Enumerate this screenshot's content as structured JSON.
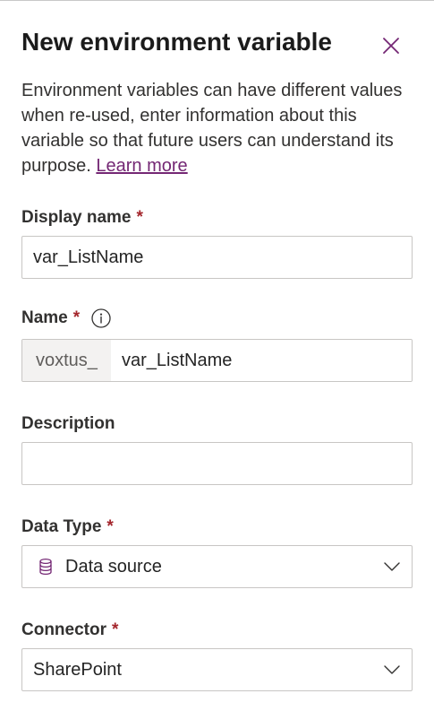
{
  "panel": {
    "title": "New environment variable",
    "description": "Environment variables can have different values when re-used, enter information about this variable so that future users can understand its purpose.",
    "learn_more": "Learn more"
  },
  "fields": {
    "display_name": {
      "label": "Display name",
      "required_mark": "*",
      "value": "var_ListName"
    },
    "name": {
      "label": "Name",
      "required_mark": "*",
      "prefix": "voxtus_",
      "value": "var_ListName"
    },
    "description": {
      "label": "Description",
      "value": ""
    },
    "data_type": {
      "label": "Data Type",
      "required_mark": "*",
      "value": "Data source",
      "icon": "database-icon"
    },
    "connector": {
      "label": "Connector",
      "required_mark": "*",
      "value": "SharePoint"
    }
  },
  "colors": {
    "accent": "#742774",
    "required": "#a4262c",
    "border": "#c8c6c4",
    "prefix_bg": "#f3f2f1"
  }
}
